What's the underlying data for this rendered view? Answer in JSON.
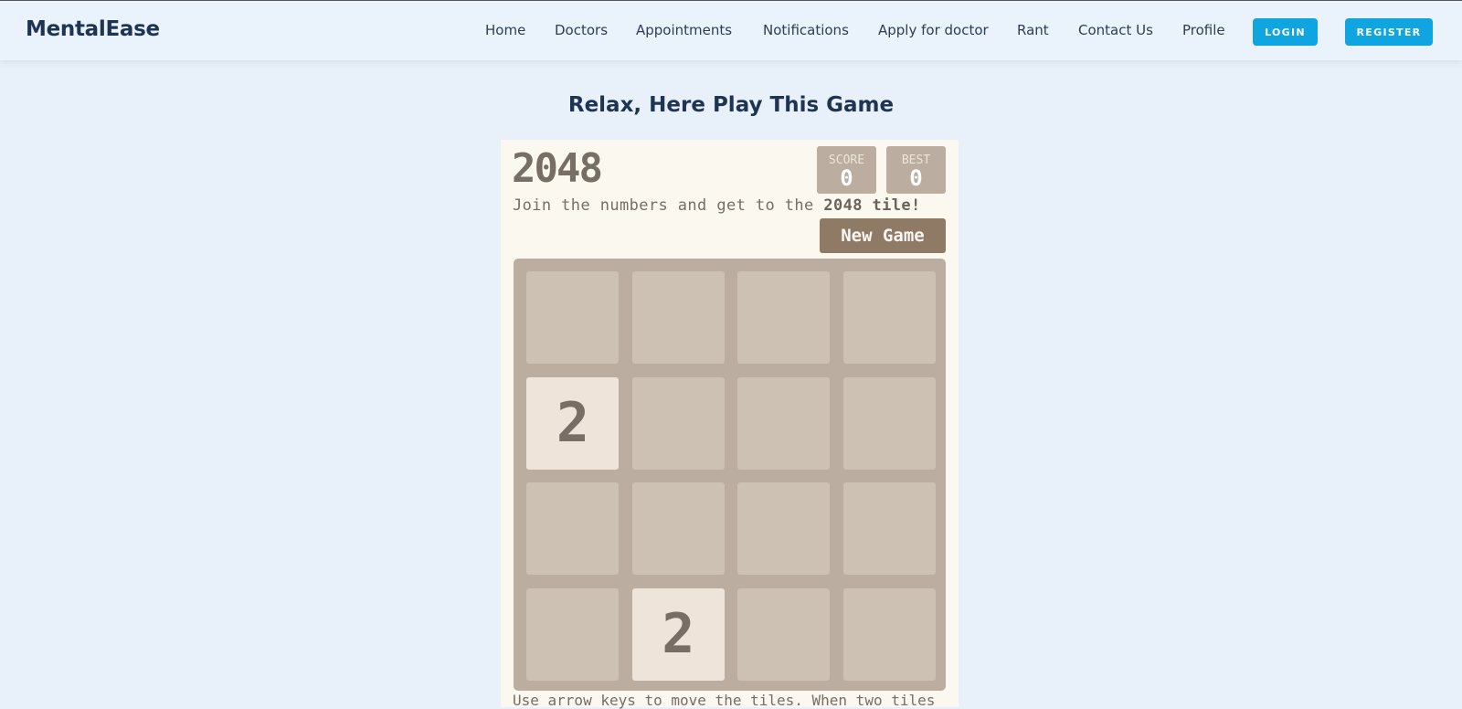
{
  "nav": {
    "brand": "MentalEase",
    "links": [
      "Home",
      "Doctors",
      "Appointments",
      "Notifications",
      "Apply for doctor",
      "Rant",
      "Contact Us",
      "Profile"
    ],
    "login_label": "LOGIN",
    "register_label": "REGISTER"
  },
  "main": {
    "title": "Relax, Here Play This Game"
  },
  "game": {
    "title": "2048",
    "score_label": "SCORE",
    "score_value": "0",
    "best_label": "BEST",
    "best_value": "0",
    "intro_prefix": "Join the numbers and get to the",
    "intro_bold": "2048 tile!",
    "new_game_label": "New Game",
    "grid": [
      [
        "",
        "",
        "",
        ""
      ],
      [
        "2",
        "",
        "",
        ""
      ],
      [
        "",
        "",
        "",
        ""
      ],
      [
        "",
        "2",
        "",
        ""
      ]
    ],
    "instructions": "Use arrow keys to move the tiles. When two tiles"
  },
  "colors": {
    "page_bg": "#e8f0fa",
    "brand_text": "#1f3352",
    "accent_button": "#0ea5e0",
    "game_bg": "#faf8ef",
    "board_bg": "#bbada0",
    "cell_empty": "#cdc1b4",
    "tile_2": "#eee4da",
    "new_game_button": "#8f7a66"
  }
}
